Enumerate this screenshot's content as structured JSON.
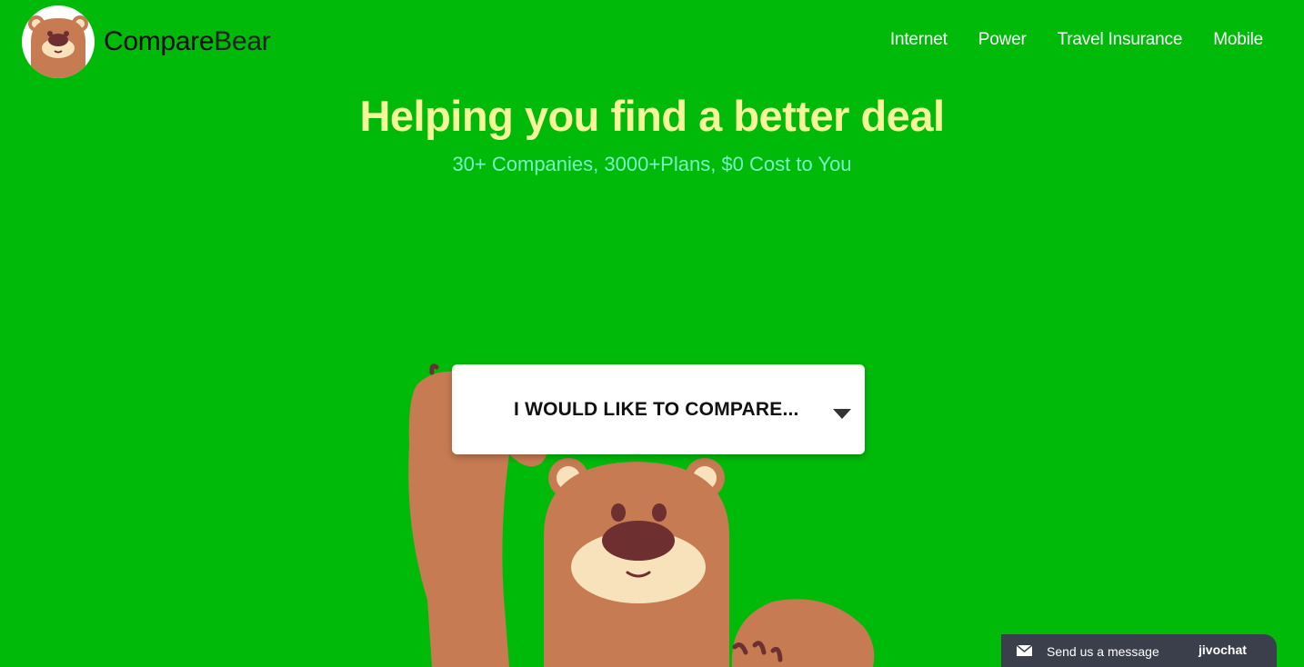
{
  "brand": {
    "name_part1": "Compare",
    "name_part2": "Bear"
  },
  "nav": {
    "items": [
      {
        "label": "Internet"
      },
      {
        "label": "Power"
      },
      {
        "label": "Travel Insurance"
      },
      {
        "label": "Mobile"
      }
    ]
  },
  "hero": {
    "title": "Helping you find a better deal",
    "subtitle": "30+ Companies, 3000+Plans, $0 Cost to You"
  },
  "compare": {
    "label": "I WOULD LIKE TO COMPARE..."
  },
  "chat": {
    "label": "Send us a message",
    "brand": "jivochat"
  },
  "colors": {
    "background": "#00ba0a",
    "title": "#f7f59a",
    "subtitle": "#7af5c4",
    "bear_fur": "#c67b52",
    "bear_nose": "#6d2f2f",
    "bear_muzzle": "#f7e2bc"
  },
  "icons": [
    "bear-logo-icon",
    "chevron-down-icon",
    "envelope-icon",
    "bear-illustration"
  ]
}
